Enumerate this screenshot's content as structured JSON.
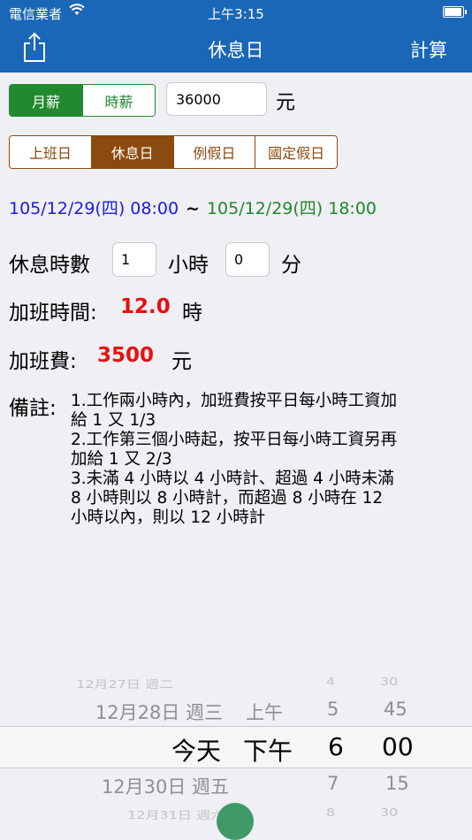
{
  "status_bar": {
    "carrier": "電信業者",
    "time": "上午3:15"
  },
  "nav": {
    "title": "休息日",
    "right_button": "計算"
  },
  "salary_type": {
    "options": [
      "月薪",
      "時薪"
    ],
    "selected": "月薪"
  },
  "salary": {
    "value": "36000",
    "unit": "元"
  },
  "day_type": {
    "options": [
      "上班日",
      "休息日",
      "例假日",
      "國定假日"
    ],
    "selected": "休息日"
  },
  "time_range": {
    "start": "105/12/29(四) 08:00",
    "separator": "~",
    "end": "105/12/29(四) 18:00"
  },
  "rest": {
    "label": "休息時數",
    "hours": "1",
    "hours_unit": "小時",
    "minutes": "0",
    "minutes_unit": "分"
  },
  "overtime_hours": {
    "label": "加班時間:",
    "value": "12.0",
    "unit": "時"
  },
  "overtime_pay": {
    "label": "加班費:",
    "value": "3500",
    "unit": "元"
  },
  "notes": {
    "label": "備註:",
    "lines": [
      "1.工作兩小時內，加班費按平日每小時工資加",
      "給 1 又 1/3",
      "2.工作第三個小時起，按平日每小時工資另再",
      "加給 1 又 2/3",
      "3.未滿 4 小時以 4 小時計、超過 4 小時未滿",
      "8 小時則以 8 小時計，而超過 8 小時在 12",
      "小時以內，則以 12 小時計"
    ]
  },
  "picker": {
    "rows": [
      {
        "date": "12月27日 週二",
        "ampm": "",
        "hour": "4",
        "minute": "30"
      },
      {
        "date": "12月28日 週三",
        "ampm": "上午",
        "hour": "5",
        "minute": "45"
      },
      {
        "date": "今天",
        "ampm": "下午",
        "hour": "6",
        "minute": "00"
      },
      {
        "date": "12月30日 週五",
        "ampm": "",
        "hour": "7",
        "minute": "15"
      },
      {
        "date": "12月31日 週六",
        "ampm": "",
        "hour": "8",
        "minute": "30"
      }
    ]
  }
}
